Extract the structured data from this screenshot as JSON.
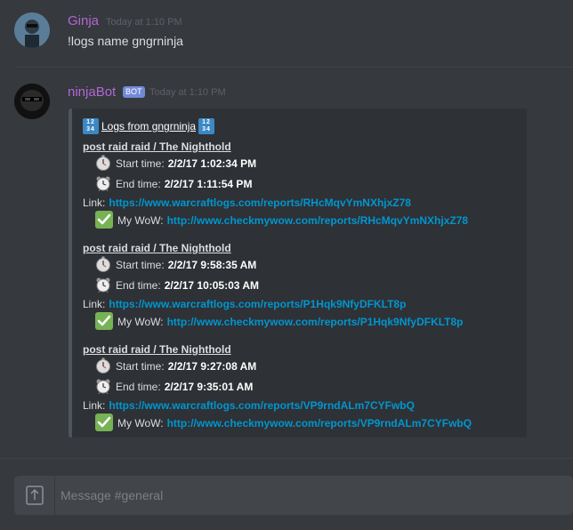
{
  "messages": [
    {
      "username": "Ginja",
      "timestamp": "Today at 1:10 PM",
      "content": "!logs name gngrninja"
    },
    {
      "username": "ninjaBot",
      "badge": "BOT",
      "timestamp": "Today at 1:10 PM",
      "embed": {
        "title": "Logs from gngrninja",
        "num_emoji_top": "12",
        "num_emoji_bottom": "34",
        "logs": [
          {
            "heading": "post raid raid / The Nighthold",
            "start_label": "Start time:",
            "start": "2/2/17 1:02:34 PM",
            "end_label": "End time:",
            "end": "2/2/17 1:11:54 PM",
            "link_label": "Link:",
            "link": "https://www.warcraftlogs.com/reports/RHcMqvYmNXhjxZ78",
            "wow_label": "My WoW:",
            "wow": "http://www.checkmywow.com/reports/RHcMqvYmNXhjxZ78"
          },
          {
            "heading": "post raid raid / The Nighthold",
            "start_label": "Start time:",
            "start": "2/2/17 9:58:35 AM",
            "end_label": "End time:",
            "end": "2/2/17 10:05:03 AM",
            "link_label": "Link:",
            "link": "https://www.warcraftlogs.com/reports/P1Hqk9NfyDFKLT8p",
            "wow_label": "My WoW:",
            "wow": "http://www.checkmywow.com/reports/P1Hqk9NfyDFKLT8p"
          },
          {
            "heading": "post raid raid / The Nighthold",
            "start_label": "Start time:",
            "start": "2/2/17 9:27:08 AM",
            "end_label": "End time:",
            "end": "2/2/17 9:35:01 AM",
            "link_label": "Link:",
            "link": "https://www.warcraftlogs.com/reports/VP9rndALm7CYFwbQ",
            "wow_label": "My WoW:",
            "wow": "http://www.checkmywow.com/reports/VP9rndALm7CYFwbQ"
          }
        ]
      }
    }
  ],
  "chat": {
    "placeholder": "Message #general"
  },
  "icons": {
    "start": "stopwatch-icon",
    "end": "alarm-clock-icon",
    "wow": "check-mark-icon",
    "title": "input-numbers-icon",
    "upload": "upload-icon"
  },
  "colors": {
    "background": "#36393e",
    "username": "#b167d6",
    "link": "#0096cf",
    "bot_badge": "#7289da",
    "embed_bg": "#2e3136",
    "checkmark_bg": "#77b255"
  }
}
